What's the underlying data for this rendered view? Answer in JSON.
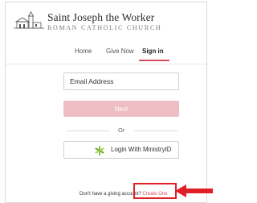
{
  "brand": {
    "name": "Saint Joseph the Worker",
    "subtitle": "ROMAN CATHOLIC CHURCH",
    "logo_icon": "church-building-icon"
  },
  "nav": {
    "tabs": [
      {
        "label": "Home",
        "active": false
      },
      {
        "label": "Give Now",
        "active": false
      },
      {
        "label": "Sign in",
        "active": true
      }
    ],
    "accent_color": "#d64b5e"
  },
  "form": {
    "email_placeholder": "Email Address",
    "next_label": "Next",
    "next_color": "#eebec4",
    "divider_label": "Or",
    "ministry_label": "Login With MinistryID",
    "ministry_icon": "ministry-asterisk-icon"
  },
  "footer": {
    "prompt": "Don't have a giving account? ",
    "create_link": "Create One"
  },
  "annotation": {
    "highlight_color": "#e01f26",
    "arrow_icon": "red-arrow-left-icon"
  }
}
